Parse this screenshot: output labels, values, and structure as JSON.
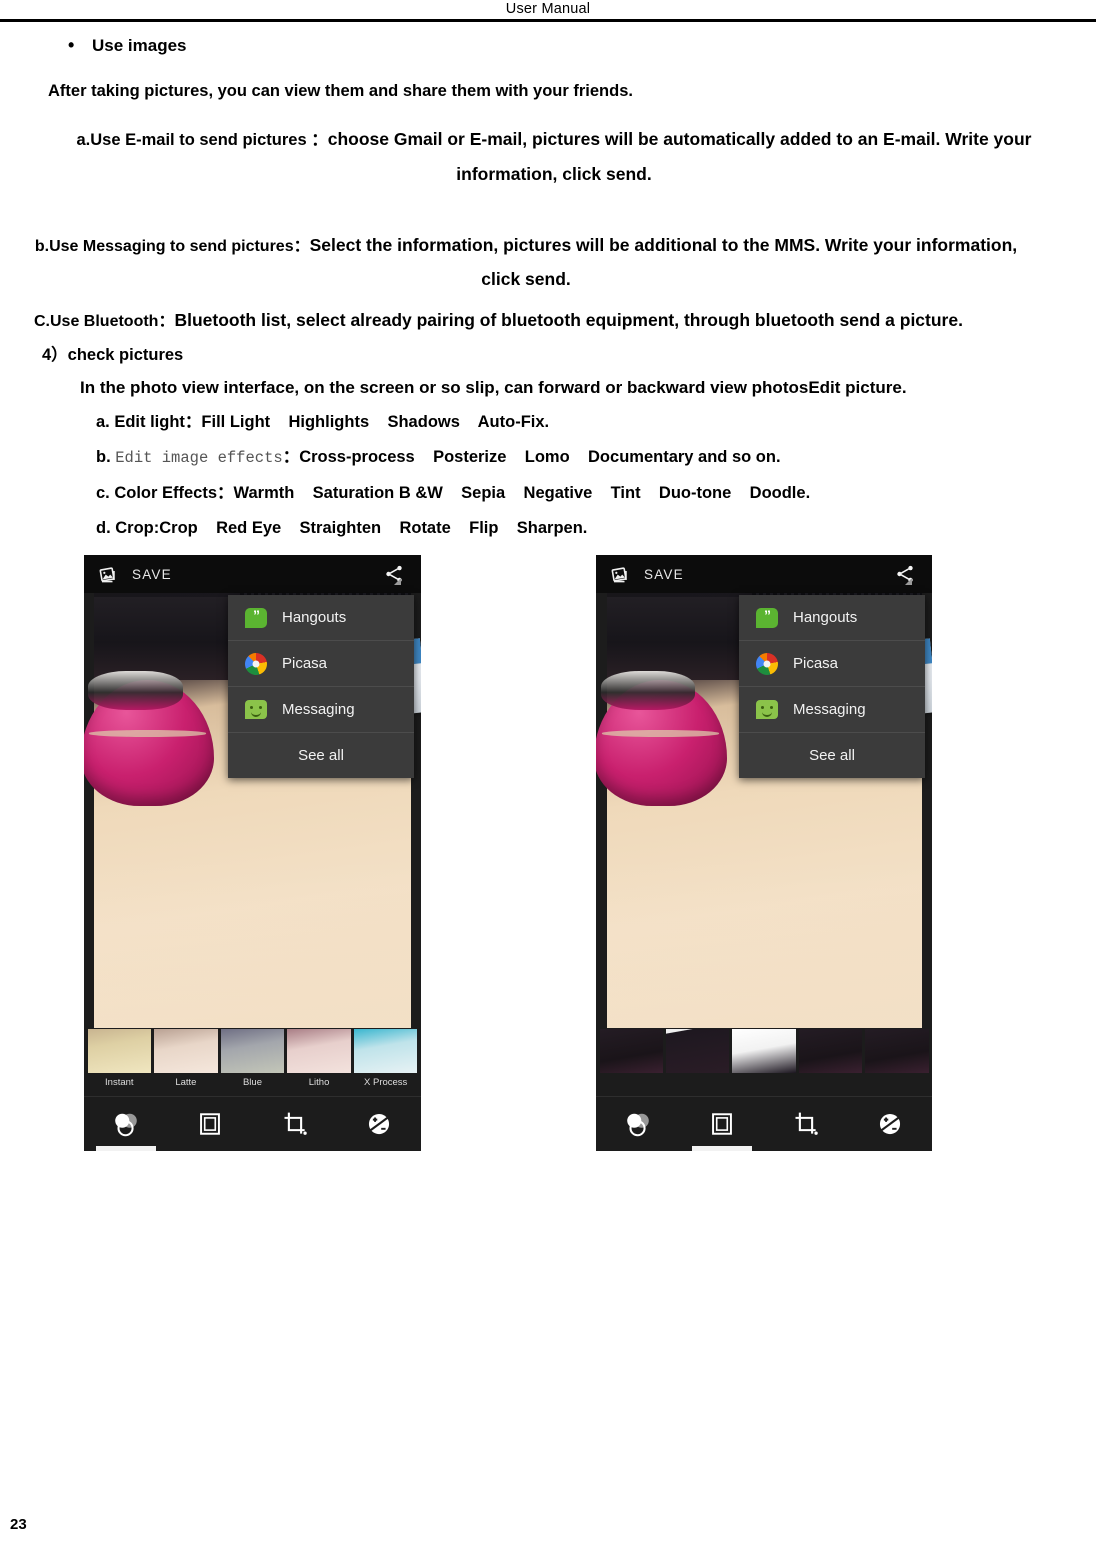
{
  "header": {
    "title": "User   Manual"
  },
  "document": {
    "bullet": "Use images",
    "intro": "After taking pictures, you can view them and share them with your friends.",
    "item_a_lead": "a.Use E-mail to send pictures ：",
    "item_a_text": "choose Gmail or E-mail, pictures will be automatically added to an E-mail.  Write your information, click send.",
    "item_b_lead": "b.Use Messaging to send pictures：",
    "item_b_text": "Select the information, pictures will be additional to the MMS. Write your information, click send.",
    "item_c_lead": "C.Use Bluetooth：",
    "item_c_text": "Bluetooth list, select already pairing of bluetooth equipment, through bluetooth send a picture.",
    "section_4": "4）check pictures",
    "section_4_text": "In the photo view interface, on the screen or so slip, can forward or backward view photosEdit picture.",
    "sub_a": "a. Edit light：Fill Light    Highlights    Shadows    Auto-Fix.",
    "sub_b_prefix": "b. ",
    "sub_b_mono": "Edit image effects",
    "sub_b_rest": "：Cross-process    Posterize    Lomo    Documentary and so on.",
    "sub_c": "c. Color Effects：Warmth    Saturation B &W    Sepia    Negative    Tint    Duo-tone    Doodle.",
    "sub_d": "d. Crop:Crop    Red Eye    Straighten    Rotate    Flip    Sharpen."
  },
  "screenshot_left": {
    "actionbar": {
      "save_label": "SAVE",
      "save_icon": "photo-stack-icon",
      "share_icon": "share-icon"
    },
    "share_menu": {
      "items": [
        {
          "label": "Hangouts",
          "icon": "hangouts-icon"
        },
        {
          "label": "Picasa",
          "icon": "picasa-icon"
        },
        {
          "label": "Messaging",
          "icon": "messaging-icon"
        }
      ],
      "see_all_label": "See all"
    },
    "filmstrip": {
      "show_labels": true,
      "thumbs": [
        {
          "label": "Instant",
          "color": "linear-gradient(170deg,#c8b490 0%,#ded0a4 35%,#f0e6c0 100%)"
        },
        {
          "label": "Latte",
          "color": "linear-gradient(170deg,#b9a193 0%,#e8d6c8 40%,#f5e7dc 100%)"
        },
        {
          "label": "Blue",
          "color": "linear-gradient(170deg,#6f6f84 0%,#a3a6ac 40%,#c3c6b8 100%)"
        },
        {
          "label": "Litho",
          "color": "linear-gradient(170deg,#a97e86 0%,#e7cfcc 40%,#f3e2dd 100%)"
        },
        {
          "label": "X Process",
          "color": "linear-gradient(170deg,#39b6cf 0%,#bfe3ea 40%,#e7f2f4 100%)"
        }
      ]
    },
    "toolbar": {
      "active_index": 0,
      "buttons": [
        {
          "name": "effects-tool"
        },
        {
          "name": "frames-tool"
        },
        {
          "name": "crop-tool"
        },
        {
          "name": "exposure-tool"
        }
      ]
    }
  },
  "screenshot_right": {
    "actionbar": {
      "save_label": "SAVE",
      "save_icon": "photo-stack-icon",
      "share_icon": "share-icon"
    },
    "share_menu": {
      "items": [
        {
          "label": "Hangouts",
          "icon": "hangouts-icon"
        },
        {
          "label": "Picasa",
          "icon": "picasa-icon"
        },
        {
          "label": "Messaging",
          "icon": "messaging-icon"
        }
      ],
      "see_all_label": "See all"
    },
    "filmstrip": {
      "show_labels": false,
      "thumbs": [
        {
          "label": "",
          "color": "linear-gradient(170deg,#241c24 0%,#1a1419 60%,#3a2030 100%)"
        },
        {
          "label": "",
          "color": "linear-gradient(170deg,#f0f0f0 0%,#f0f0f0 8%,#1e1820 9%,#2a1c26 100%)"
        },
        {
          "label": "",
          "color": "linear-gradient(170deg,#ffffff 0%,#f2f2f2 45%,#1c1620 100%)"
        },
        {
          "label": "",
          "color": "linear-gradient(170deg,#241c24 0%,#1a1419 60%,#3a2030 100%)"
        },
        {
          "label": "",
          "color": "linear-gradient(170deg,#241c24 0%,#1a1419 60%,#3a2030 100%)"
        }
      ]
    },
    "toolbar": {
      "active_index": 1,
      "buttons": [
        {
          "name": "effects-tool"
        },
        {
          "name": "frames-tool"
        },
        {
          "name": "crop-tool"
        },
        {
          "name": "exposure-tool"
        }
      ]
    }
  },
  "footer": {
    "page_number": "23"
  }
}
